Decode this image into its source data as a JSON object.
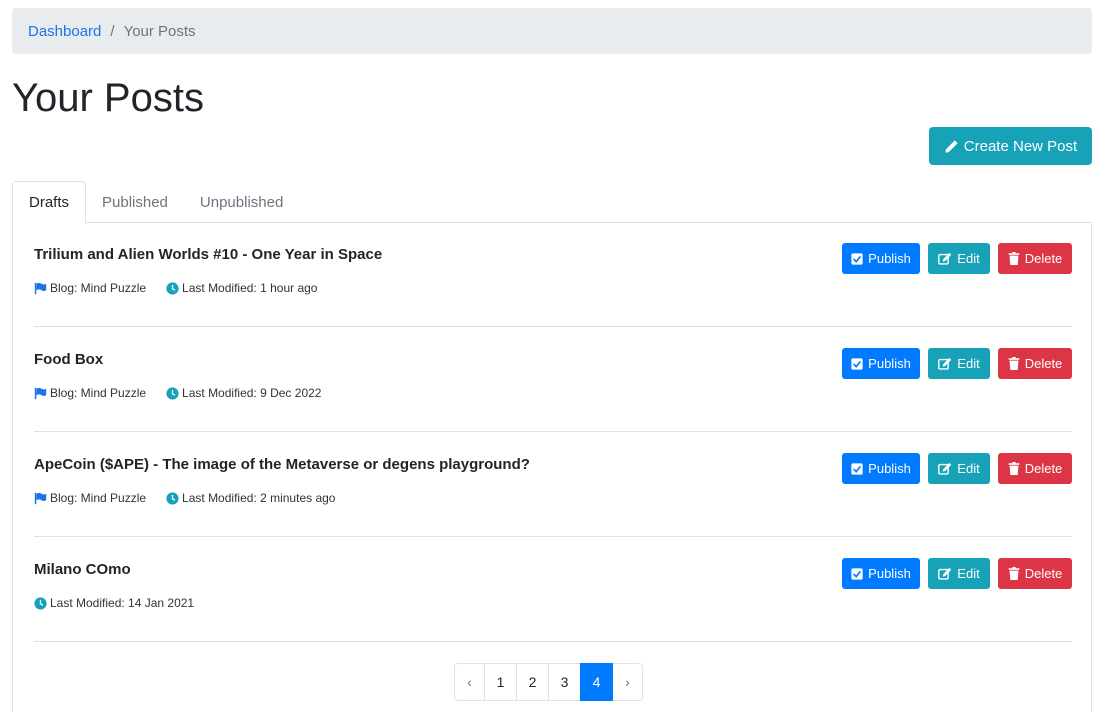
{
  "breadcrumb": {
    "home": "Dashboard",
    "separator": "/",
    "current": "Your Posts"
  },
  "page_title": "Your Posts",
  "create_button": "Create New Post",
  "tabs": [
    {
      "label": "Drafts",
      "active": true
    },
    {
      "label": "Published",
      "active": false
    },
    {
      "label": "Unpublished",
      "active": false
    }
  ],
  "actions": {
    "publish": "Publish",
    "edit": "Edit",
    "delete": "Delete"
  },
  "posts": [
    {
      "title": "Trilium and Alien Worlds #10 - One Year in Space",
      "blog": "Blog: Mind Puzzle",
      "modified": "Last Modified: 1 hour ago"
    },
    {
      "title": "Food Box",
      "blog": "Blog: Mind Puzzle",
      "modified": "Last Modified: 9 Dec 2022"
    },
    {
      "title": "ApeCoin ($APE) - The image of the Metaverse or degens playground?",
      "blog": "Blog: Mind Puzzle",
      "modified": "Last Modified: 2 minutes ago"
    },
    {
      "title": "Milano COmo",
      "blog": "",
      "modified": "Last Modified: 14 Jan 2021"
    }
  ],
  "pagination": {
    "prev": "‹",
    "pages": [
      "1",
      "2",
      "3",
      "4"
    ],
    "current": "4",
    "next": "›"
  },
  "colors": {
    "primary": "#007bff",
    "info": "#17a2b8",
    "danger": "#dc3545",
    "link": "#1a73e8"
  }
}
